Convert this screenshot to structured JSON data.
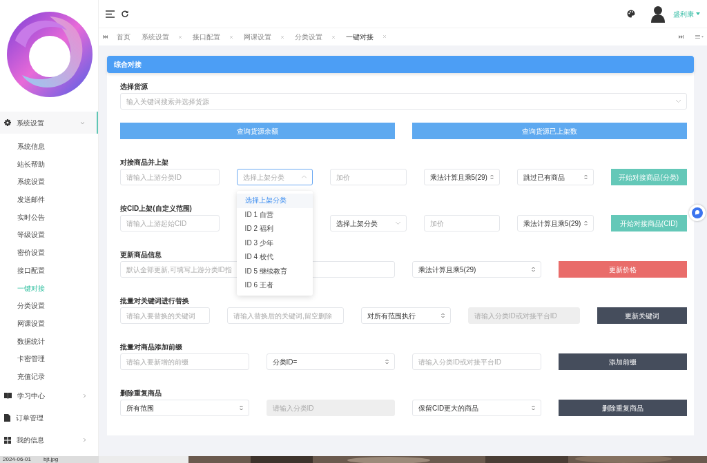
{
  "sidebar": {
    "items": [
      {
        "label": "系统设置",
        "expanded": true,
        "children": [
          {
            "label": "系统信息",
            "selected": false
          },
          {
            "label": "站长帮助",
            "selected": false
          },
          {
            "label": "系统设置",
            "selected": false
          },
          {
            "label": "发送邮件",
            "selected": false
          },
          {
            "label": "实时公告",
            "selected": false
          },
          {
            "label": "等级设置",
            "selected": false
          },
          {
            "label": "密价设置",
            "selected": false
          },
          {
            "label": "接口配置",
            "selected": false
          },
          {
            "label": "一键对接",
            "selected": true
          },
          {
            "label": "分类设置",
            "selected": false
          },
          {
            "label": "网课设置",
            "selected": false
          },
          {
            "label": "数据统计",
            "selected": false
          },
          {
            "label": "卡密管理",
            "selected": false
          },
          {
            "label": "充值记录",
            "selected": false
          }
        ]
      },
      {
        "label": "学习中心",
        "expanded": false
      },
      {
        "label": "订单管理"
      },
      {
        "label": "我的信息",
        "expanded": false
      }
    ]
  },
  "header": {
    "user_name": "盛利康"
  },
  "tabs": [
    {
      "label": "首页",
      "closable": false,
      "selected": false
    },
    {
      "label": "系统设置",
      "closable": true,
      "selected": false
    },
    {
      "label": "接口配置",
      "closable": true,
      "selected": false
    },
    {
      "label": "网课设置",
      "closable": true,
      "selected": false
    },
    {
      "label": "分类设置",
      "closable": true,
      "selected": false
    },
    {
      "label": "一键对接",
      "closable": true,
      "selected": true
    }
  ],
  "card": {
    "title": "综合对接",
    "source": {
      "label": "选择货源",
      "placeholder": "输入关键词搜索并选择货源"
    },
    "top_buttons": [
      {
        "label": "查询货源余额"
      },
      {
        "label": "查询货源已上架数"
      }
    ],
    "sections": [
      {
        "title": "对接商品并上架",
        "fields": [
          {
            "kind": "input",
            "placeholder": "请输入上游分类ID"
          },
          {
            "kind": "select",
            "placeholder": "选择上架分类",
            "open": true,
            "options": [
              {
                "label": "选择上架分类",
                "selected": true
              },
              {
                "label": "ID 1 自营",
                "selected": false
              },
              {
                "label": "ID 2 福利",
                "selected": false
              },
              {
                "label": "ID 3 少年",
                "selected": false
              },
              {
                "label": "ID 4 校代",
                "selected": false
              },
              {
                "label": "ID 5 继续教育",
                "selected": false
              },
              {
                "label": "ID 6 王者",
                "selected": false
              }
            ]
          },
          {
            "kind": "input",
            "placeholder": "加价"
          },
          {
            "kind": "spinner",
            "value": "乘法计算且乘5(29)"
          },
          {
            "kind": "spinner",
            "value": "跳过已有商品"
          }
        ],
        "button": {
          "label": "开始对接商品(分类)",
          "kind": "success"
        }
      },
      {
        "title": "按CID上架(自定义范围)",
        "fields": [
          {
            "kind": "input",
            "placeholder": "请输入上游起始CID"
          },
          {
            "kind": "select",
            "value": "选择上架分类",
            "open": false
          },
          {
            "kind": "input",
            "placeholder": "加价"
          },
          {
            "kind": "spinner",
            "value": "乘法计算且乘5(29)"
          }
        ],
        "button": {
          "label": "开始对接商品(CID)",
          "kind": "success"
        }
      },
      {
        "title": "更新商品信息",
        "fields": [
          {
            "kind": "input",
            "placeholder": "默认全部更新,可填写上游分类ID指"
          },
          {
            "kind": "spinner",
            "value": "乘法计算且乘5(29)"
          }
        ],
        "button": {
          "label": "更新价格",
          "kind": "danger"
        }
      },
      {
        "title": "批量对关键词进行替换",
        "fields": [
          {
            "kind": "input",
            "placeholder": "请输入要替换的关键词"
          },
          {
            "kind": "input",
            "placeholder": "请输入替换后的关键词,留空删除"
          },
          {
            "kind": "spinner",
            "value": "对所有范围执行"
          },
          {
            "kind": "disabled",
            "placeholder": "请输入分类ID或对接平台ID"
          }
        ],
        "button": {
          "label": "更新关键词",
          "kind": "dark"
        }
      },
      {
        "title": "批量对商品添加前缀",
        "fields": [
          {
            "kind": "input",
            "placeholder": "请输入要新增的前缀"
          },
          {
            "kind": "spinner",
            "value": "分类ID="
          },
          {
            "kind": "input",
            "placeholder": "请输入分类ID或对接平台ID"
          }
        ],
        "button": {
          "label": "添加前缀",
          "kind": "dark"
        }
      },
      {
        "title": "删除重复商品",
        "fields": [
          {
            "kind": "spinner",
            "value": "所有范围"
          },
          {
            "kind": "disabled",
            "placeholder": "请输入分类ID"
          },
          {
            "kind": "spinner",
            "value": "保留CID更大的商品"
          }
        ],
        "button": {
          "label": "删除重复商品",
          "kind": "dark"
        }
      }
    ]
  },
  "background_window": {
    "texts": [
      "2024-06-01",
      "bjt.jpg"
    ]
  }
}
